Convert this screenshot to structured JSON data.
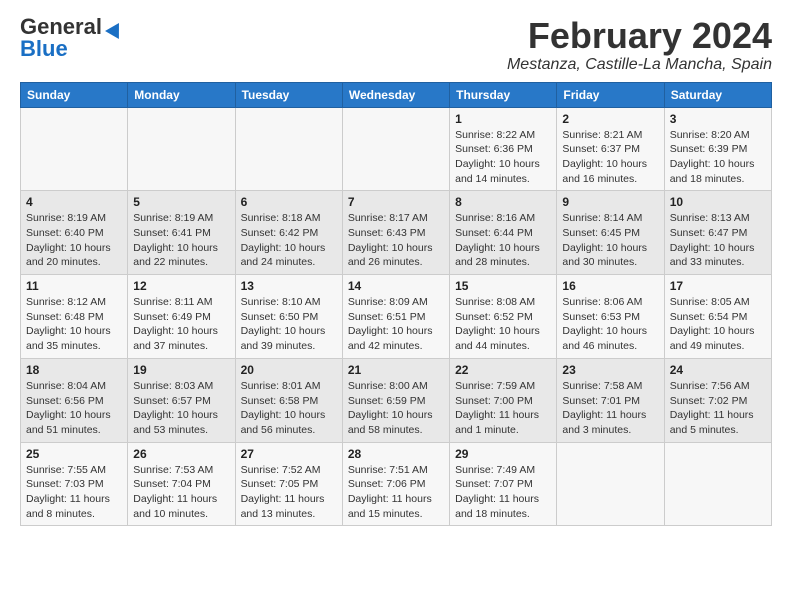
{
  "header": {
    "logo_general": "General",
    "logo_blue": "Blue",
    "month_title": "February 2024",
    "location": "Mestanza, Castille-La Mancha, Spain"
  },
  "weekdays": [
    "Sunday",
    "Monday",
    "Tuesday",
    "Wednesday",
    "Thursday",
    "Friday",
    "Saturday"
  ],
  "weeks": [
    [
      {
        "day": "",
        "info": ""
      },
      {
        "day": "",
        "info": ""
      },
      {
        "day": "",
        "info": ""
      },
      {
        "day": "",
        "info": ""
      },
      {
        "day": "1",
        "info": "Sunrise: 8:22 AM\nSunset: 6:36 PM\nDaylight: 10 hours\nand 14 minutes."
      },
      {
        "day": "2",
        "info": "Sunrise: 8:21 AM\nSunset: 6:37 PM\nDaylight: 10 hours\nand 16 minutes."
      },
      {
        "day": "3",
        "info": "Sunrise: 8:20 AM\nSunset: 6:39 PM\nDaylight: 10 hours\nand 18 minutes."
      }
    ],
    [
      {
        "day": "4",
        "info": "Sunrise: 8:19 AM\nSunset: 6:40 PM\nDaylight: 10 hours\nand 20 minutes."
      },
      {
        "day": "5",
        "info": "Sunrise: 8:19 AM\nSunset: 6:41 PM\nDaylight: 10 hours\nand 22 minutes."
      },
      {
        "day": "6",
        "info": "Sunrise: 8:18 AM\nSunset: 6:42 PM\nDaylight: 10 hours\nand 24 minutes."
      },
      {
        "day": "7",
        "info": "Sunrise: 8:17 AM\nSunset: 6:43 PM\nDaylight: 10 hours\nand 26 minutes."
      },
      {
        "day": "8",
        "info": "Sunrise: 8:16 AM\nSunset: 6:44 PM\nDaylight: 10 hours\nand 28 minutes."
      },
      {
        "day": "9",
        "info": "Sunrise: 8:14 AM\nSunset: 6:45 PM\nDaylight: 10 hours\nand 30 minutes."
      },
      {
        "day": "10",
        "info": "Sunrise: 8:13 AM\nSunset: 6:47 PM\nDaylight: 10 hours\nand 33 minutes."
      }
    ],
    [
      {
        "day": "11",
        "info": "Sunrise: 8:12 AM\nSunset: 6:48 PM\nDaylight: 10 hours\nand 35 minutes."
      },
      {
        "day": "12",
        "info": "Sunrise: 8:11 AM\nSunset: 6:49 PM\nDaylight: 10 hours\nand 37 minutes."
      },
      {
        "day": "13",
        "info": "Sunrise: 8:10 AM\nSunset: 6:50 PM\nDaylight: 10 hours\nand 39 minutes."
      },
      {
        "day": "14",
        "info": "Sunrise: 8:09 AM\nSunset: 6:51 PM\nDaylight: 10 hours\nand 42 minutes."
      },
      {
        "day": "15",
        "info": "Sunrise: 8:08 AM\nSunset: 6:52 PM\nDaylight: 10 hours\nand 44 minutes."
      },
      {
        "day": "16",
        "info": "Sunrise: 8:06 AM\nSunset: 6:53 PM\nDaylight: 10 hours\nand 46 minutes."
      },
      {
        "day": "17",
        "info": "Sunrise: 8:05 AM\nSunset: 6:54 PM\nDaylight: 10 hours\nand 49 minutes."
      }
    ],
    [
      {
        "day": "18",
        "info": "Sunrise: 8:04 AM\nSunset: 6:56 PM\nDaylight: 10 hours\nand 51 minutes."
      },
      {
        "day": "19",
        "info": "Sunrise: 8:03 AM\nSunset: 6:57 PM\nDaylight: 10 hours\nand 53 minutes."
      },
      {
        "day": "20",
        "info": "Sunrise: 8:01 AM\nSunset: 6:58 PM\nDaylight: 10 hours\nand 56 minutes."
      },
      {
        "day": "21",
        "info": "Sunrise: 8:00 AM\nSunset: 6:59 PM\nDaylight: 10 hours\nand 58 minutes."
      },
      {
        "day": "22",
        "info": "Sunrise: 7:59 AM\nSunset: 7:00 PM\nDaylight: 11 hours\nand 1 minute."
      },
      {
        "day": "23",
        "info": "Sunrise: 7:58 AM\nSunset: 7:01 PM\nDaylight: 11 hours\nand 3 minutes."
      },
      {
        "day": "24",
        "info": "Sunrise: 7:56 AM\nSunset: 7:02 PM\nDaylight: 11 hours\nand 5 minutes."
      }
    ],
    [
      {
        "day": "25",
        "info": "Sunrise: 7:55 AM\nSunset: 7:03 PM\nDaylight: 11 hours\nand 8 minutes."
      },
      {
        "day": "26",
        "info": "Sunrise: 7:53 AM\nSunset: 7:04 PM\nDaylight: 11 hours\nand 10 minutes."
      },
      {
        "day": "27",
        "info": "Sunrise: 7:52 AM\nSunset: 7:05 PM\nDaylight: 11 hours\nand 13 minutes."
      },
      {
        "day": "28",
        "info": "Sunrise: 7:51 AM\nSunset: 7:06 PM\nDaylight: 11 hours\nand 15 minutes."
      },
      {
        "day": "29",
        "info": "Sunrise: 7:49 AM\nSunset: 7:07 PM\nDaylight: 11 hours\nand 18 minutes."
      },
      {
        "day": "",
        "info": ""
      },
      {
        "day": "",
        "info": ""
      }
    ]
  ]
}
